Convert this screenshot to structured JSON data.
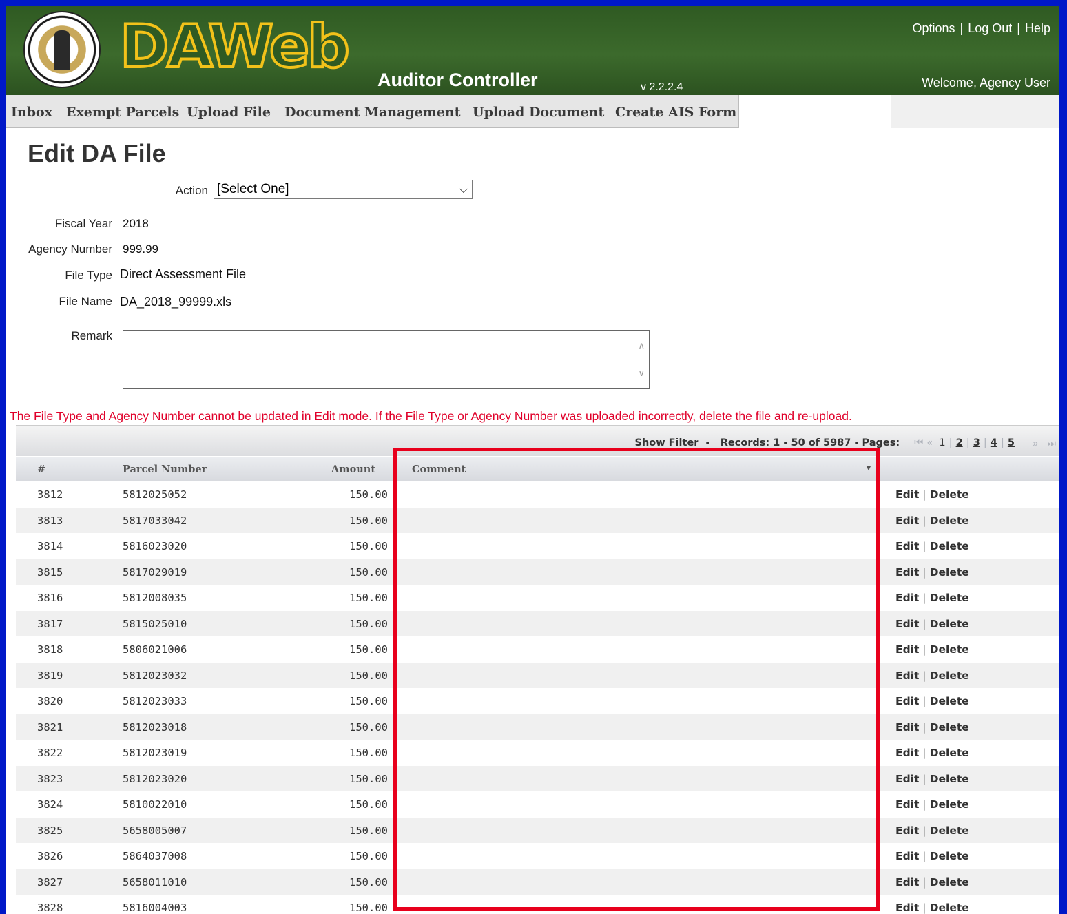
{
  "header": {
    "logo_text": "DAWeb",
    "app_name": "Auditor Controller",
    "version": "v 2.2.2.4",
    "links": [
      "Options",
      "Log Out",
      "Help"
    ],
    "welcome": "Welcome, Agency User"
  },
  "nav": [
    "Inbox",
    "Exempt Parcels",
    "Upload File",
    "Document Management",
    "Upload Document",
    "Create AIS Form"
  ],
  "page_title": "Edit DA File",
  "form": {
    "action_label": "Action",
    "action_value": "[Select One]",
    "fiscal_year_label": "Fiscal Year",
    "fiscal_year": "2018",
    "agency_number_label": "Agency Number",
    "agency_number": "999.99",
    "file_type_label": "File Type",
    "file_type": "Direct Assessment File",
    "file_name_label": "File Name",
    "file_name": "DA_2018_99999.xls",
    "remark_label": "Remark",
    "remark_value": ""
  },
  "warning": "The File Type and Agency Number cannot be updated in Edit mode. If the File Type or Agency Number was uploaded incorrectly, delete the file and re-upload.",
  "pager": {
    "show_filter": "Show Filter",
    "records": "Records: 1 - 50 of 5987",
    "pages_label": "Pages:",
    "pages": [
      "1",
      "2",
      "3",
      "4",
      "5"
    ]
  },
  "columns": [
    "#",
    "Parcel Number",
    "Amount",
    "Comment"
  ],
  "row_actions": {
    "edit": "Edit",
    "delete": "Delete"
  },
  "rows": [
    {
      "num": "3812",
      "parcel": "5812025052",
      "amount": "150.00",
      "comment": ""
    },
    {
      "num": "3813",
      "parcel": "5817033042",
      "amount": "150.00",
      "comment": ""
    },
    {
      "num": "3814",
      "parcel": "5816023020",
      "amount": "150.00",
      "comment": ""
    },
    {
      "num": "3815",
      "parcel": "5817029019",
      "amount": "150.00",
      "comment": ""
    },
    {
      "num": "3816",
      "parcel": "5812008035",
      "amount": "150.00",
      "comment": ""
    },
    {
      "num": "3817",
      "parcel": "5815025010",
      "amount": "150.00",
      "comment": ""
    },
    {
      "num": "3818",
      "parcel": "5806021006",
      "amount": "150.00",
      "comment": ""
    },
    {
      "num": "3819",
      "parcel": "5812023032",
      "amount": "150.00",
      "comment": ""
    },
    {
      "num": "3820",
      "parcel": "5812023033",
      "amount": "150.00",
      "comment": ""
    },
    {
      "num": "3821",
      "parcel": "5812023018",
      "amount": "150.00",
      "comment": ""
    },
    {
      "num": "3822",
      "parcel": "5812023019",
      "amount": "150.00",
      "comment": ""
    },
    {
      "num": "3823",
      "parcel": "5812023020",
      "amount": "150.00",
      "comment": ""
    },
    {
      "num": "3824",
      "parcel": "5810022010",
      "amount": "150.00",
      "comment": ""
    },
    {
      "num": "3825",
      "parcel": "5658005007",
      "amount": "150.00",
      "comment": ""
    },
    {
      "num": "3826",
      "parcel": "5864037008",
      "amount": "150.00",
      "comment": ""
    },
    {
      "num": "3827",
      "parcel": "5658011010",
      "amount": "150.00",
      "comment": ""
    },
    {
      "num": "3828",
      "parcel": "5816004003",
      "amount": "150.00",
      "comment": ""
    }
  ]
}
